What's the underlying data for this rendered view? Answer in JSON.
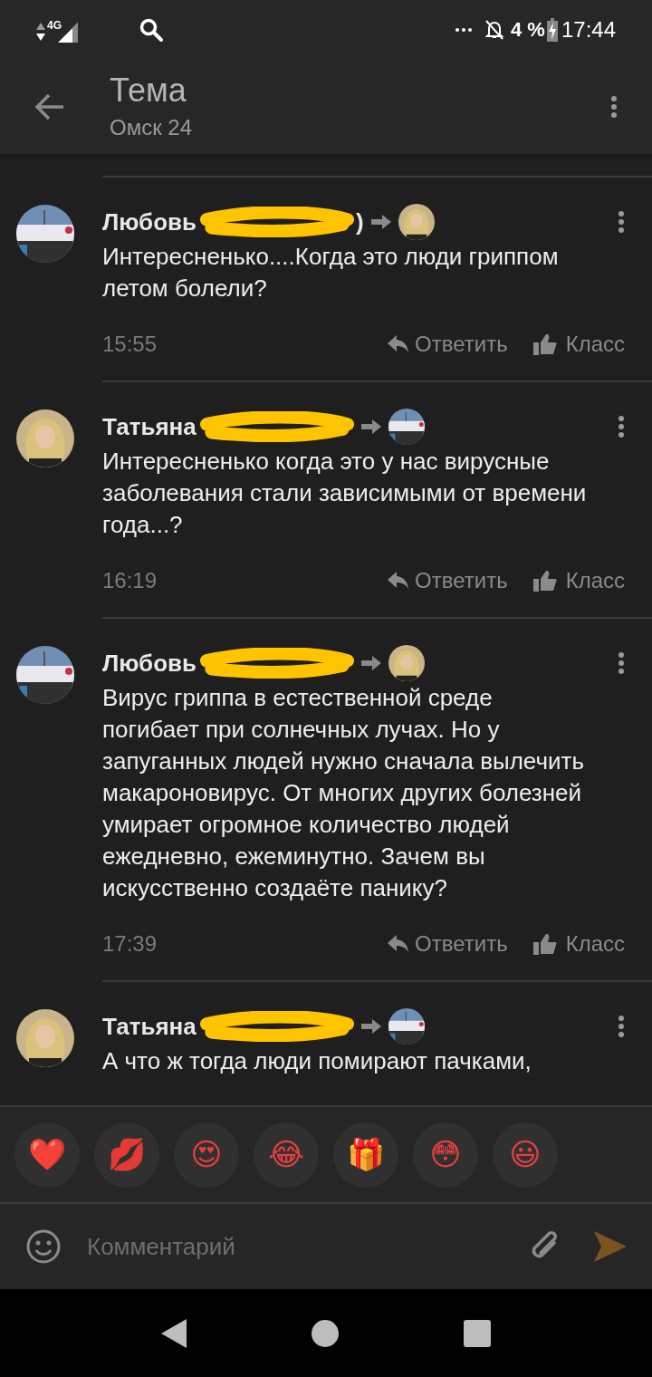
{
  "status_bar": {
    "network": "4G",
    "battery": "4 %",
    "time": "17:44"
  },
  "header": {
    "title": "Тема",
    "subtitle": "Омск 24"
  },
  "comments": [
    {
      "author": "Любовь",
      "author_tail": ")",
      "text": "Интересненько....Когда это люди гриппом летом болели?",
      "time": "15:55",
      "reply": "Ответить",
      "like": "Класс"
    },
    {
      "author": "Татьяна",
      "text": "Интересненько когда это у нас вирусные заболевания стали зависимыми от времени года...?",
      "time": "16:19",
      "reply": "Ответить",
      "like": "Класс"
    },
    {
      "author": "Любовь",
      "text": "Вирус гриппа в естественной среде погибает при солнечных лучах. Но у запуганных людей нужно сначала вылечить макароновирус. От многих других болезней умирает огромное количество людей ежедневно, ежеминутно. Зачем вы искусственно создаёте панику?",
      "time": "17:39",
      "reply": "Ответить",
      "like": "Класс"
    },
    {
      "author": "Татьяна",
      "text": "А что ж тогда люди помирают пачками,"
    }
  ],
  "reactions": [
    "❤️",
    "💋",
    "😍",
    "😂",
    "🎁",
    "😳",
    "😃"
  ],
  "composer": {
    "placeholder": "Комментарий"
  }
}
